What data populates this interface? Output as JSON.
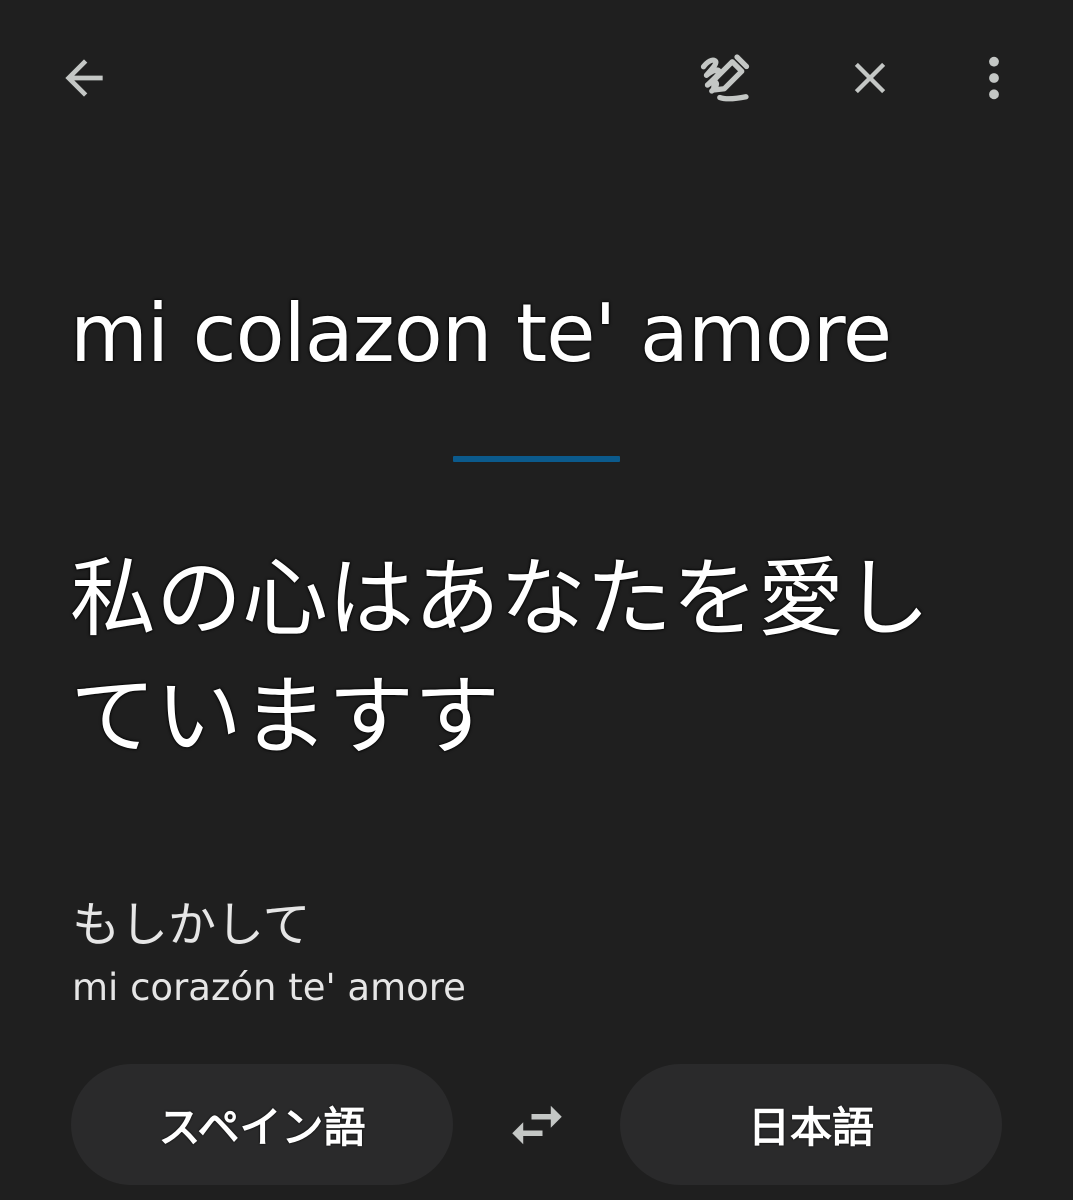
{
  "toolbar": {
    "back_icon": "arrow-back-icon",
    "handwrite_icon": "handwriting-icon",
    "clear_icon": "close-icon",
    "more_icon": "more-vert-icon"
  },
  "translation": {
    "source_text": "mi colazon te' amore",
    "translated_text": "私の心はあなたを愛していますす",
    "divider_color": "#0b5a8c"
  },
  "suggestion": {
    "label": "もしかして",
    "text": "mi corazón te' amore"
  },
  "languages": {
    "source": "スペイン語",
    "target": "日本語",
    "swap_icon": "swap-horiz-icon"
  },
  "colors": {
    "background": "#1f1f1f",
    "pill": "#2a2a2b",
    "icon": "#c4c7c5"
  }
}
